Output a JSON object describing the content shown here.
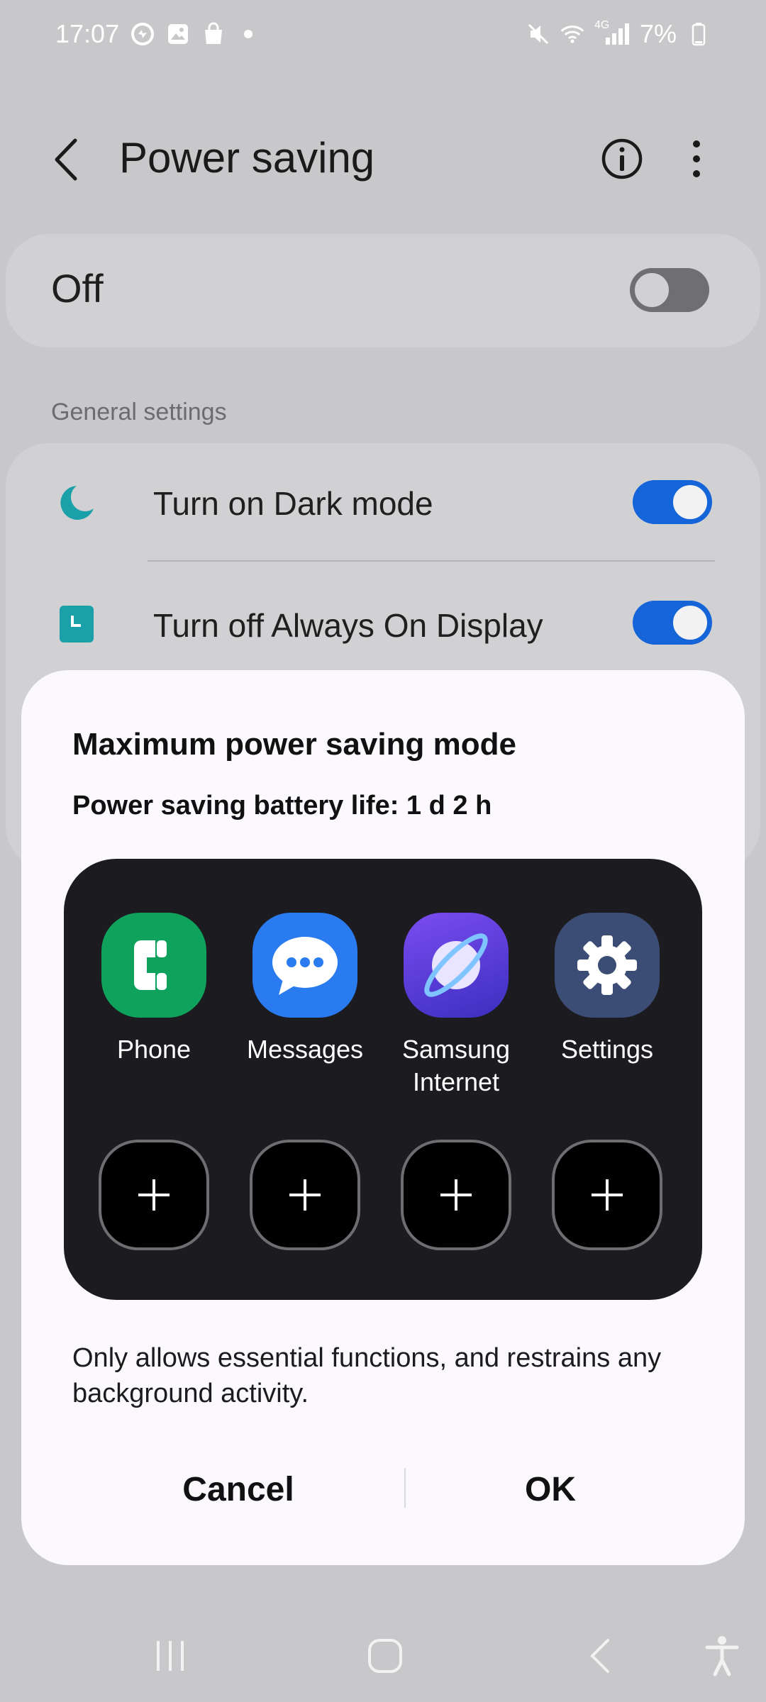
{
  "status_bar": {
    "time": "17:07",
    "network_label": "4G",
    "battery_percent": "7%"
  },
  "header": {
    "title": "Power saving"
  },
  "master_switch": {
    "label": "Off",
    "state": "off"
  },
  "general_settings": {
    "header": "General settings",
    "items": [
      {
        "label": "Turn on Dark mode",
        "icon": "moon-icon",
        "state": "on"
      },
      {
        "label": "Turn off Always On Display",
        "icon": "always-on-display-icon",
        "state": "on"
      }
    ]
  },
  "dialog": {
    "title": "Maximum power saving mode",
    "battery_life": "Power saving battery life: 1 d 2 h",
    "apps": [
      {
        "name": "Phone",
        "icon": "phone-icon",
        "color": "#0ea25c"
      },
      {
        "name": "Messages",
        "icon": "messages-icon",
        "color": "#2a7bf0"
      },
      {
        "name": "Samsung Internet",
        "name_line1": "Samsung",
        "name_line2": "Internet",
        "icon": "samsung-internet-icon",
        "color": "#5b3bd9"
      },
      {
        "name": "Settings",
        "icon": "settings-gear-icon",
        "color": "#3c4d75"
      }
    ],
    "empty_slot_count": 4,
    "description": "Only allows essential functions, and restrains any background activity.",
    "cancel_label": "Cancel",
    "ok_label": "OK"
  },
  "colors": {
    "accent": "#1565d8",
    "teal": "#1aa0a8",
    "scrim": "#c8c8cb",
    "dialog_bg": "#fbf9fd",
    "panel_bg": "#1c1b20"
  }
}
